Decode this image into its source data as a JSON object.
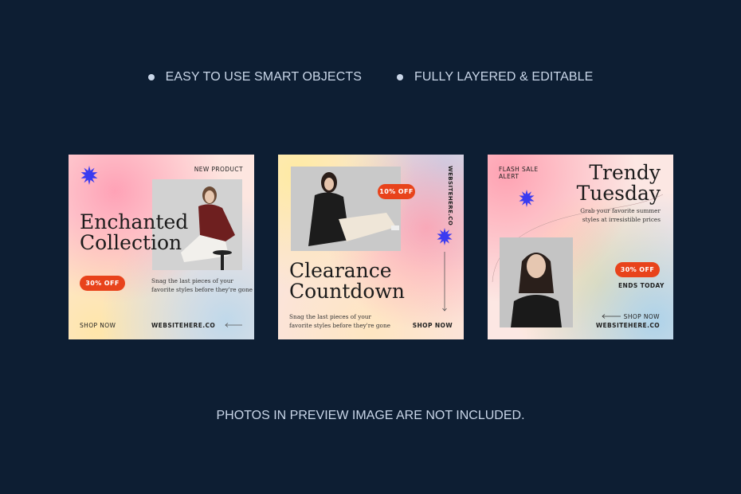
{
  "features": [
    "EASY TO USE SMART OBJECTS",
    "FULLY LAYERED & EDITABLE"
  ],
  "footer_note": "PHOTOS IN PREVIEW IMAGE ARE NOT INCLUDED.",
  "colors": {
    "background": "#0d1e33",
    "accent": "#e8431b",
    "star": "#3b3bf0"
  },
  "cards": [
    {
      "tag": "NEW PRODUCT",
      "headline_line1": "Enchanted",
      "headline_line2": "Collection",
      "badge": "30% OFF",
      "body_line1": "Snag the last pieces of your",
      "body_line2": "favorite styles before they're gone",
      "cta": "SHOP NOW",
      "website": "WEBSITEHERE.CO",
      "icon": "star-burst-icon"
    },
    {
      "website_vertical": "WEBSITEHERE.CO",
      "badge": "10% OFF",
      "headline_line1": "Clearance",
      "headline_line2": "Countdown",
      "body_line1": "Snag the last pieces of your",
      "body_line2": "favorite styles before they're gone",
      "cta": "SHOP NOW",
      "icon": "star-burst-icon"
    },
    {
      "tag_line1": "FLASH SALE",
      "tag_line2": "ALERT",
      "headline_line1": "Trendy",
      "headline_line2": "Tuesday",
      "body_line1": "Grab your favorite summer",
      "body_line2": "styles at irresistible prices",
      "badge": "30% OFF",
      "ends": "ENDS TODAY",
      "cta": "SHOP NOW",
      "website": "WEBSITEHERE.CO",
      "icon": "star-burst-icon"
    }
  ]
}
